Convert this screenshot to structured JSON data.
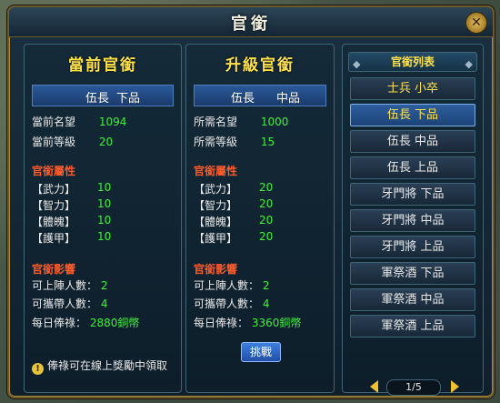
{
  "window": {
    "title": "官銜",
    "close_label": "✕"
  },
  "current": {
    "header": "當前官銜",
    "rank": "伍長",
    "grade": "下品",
    "fame_label": "當前名望",
    "fame_value": "1094",
    "level_label": "當前等級",
    "level_value": "20",
    "attr_header": "官銜屬性",
    "stats": [
      {
        "label": "【武力】",
        "value": "10"
      },
      {
        "label": "【智力】",
        "value": "10"
      },
      {
        "label": "【體魄】",
        "value": "10"
      },
      {
        "label": "【護甲】",
        "value": "10"
      }
    ],
    "effect_header": "官銜影響",
    "deploy_label": "可上陣人數：",
    "deploy_value": "2",
    "carry_label": "可攜帶人數：",
    "carry_value": "4",
    "salary_label": "每日俸祿：",
    "salary_value": "2880銅幣"
  },
  "upgrade": {
    "header": "升級官銜",
    "rank": "伍長",
    "grade": "中品",
    "fame_label": "所需名望",
    "fame_value": "1000",
    "level_label": "所需等級",
    "level_value": "15",
    "attr_header": "官銜屬性",
    "stats": [
      {
        "label": "【武力】",
        "value": "20"
      },
      {
        "label": "【智力】",
        "value": "20"
      },
      {
        "label": "【體魄】",
        "value": "20"
      },
      {
        "label": "【護甲】",
        "value": "20"
      }
    ],
    "effect_header": "官銜影響",
    "deploy_label": "可上陣人數：",
    "deploy_value": "2",
    "carry_label": "可攜帶人數：",
    "carry_value": "4",
    "salary_label": "每日俸祿：",
    "salary_value": "3360銅幣",
    "challenge_button": "挑戰"
  },
  "tip": {
    "icon": "exclamation-icon",
    "glyph": "!",
    "text": "俸祿可在線上獎勵中領取"
  },
  "rank_list": {
    "header": "官銜列表",
    "items": [
      "士兵 小卒",
      "伍長 下品",
      "伍長 中品",
      "伍長 上品",
      "牙門將 下品",
      "牙門將 中品",
      "牙門將 上品",
      "軍祭酒 下品",
      "軍祭酒 中品",
      "軍祭酒 上品"
    ],
    "selected_index": 1,
    "page": "1/5"
  },
  "colors": {
    "accent_gold": "#ffe24a",
    "value_green": "#3cf03c",
    "section_red": "#ff5a2a"
  }
}
